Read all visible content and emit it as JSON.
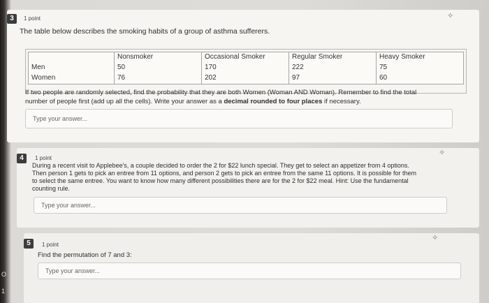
{
  "q3": {
    "number": "3",
    "points": "1 point",
    "intro": "The table below describes the smoking habits of a group of asthma sufferers.",
    "table": {
      "headers": [
        "",
        "Nonsmoker",
        "Occasional Smoker",
        "Regular Smoker",
        "Heavy Smoker"
      ],
      "rows": [
        [
          "Men",
          "50",
          "170",
          "222",
          "75"
        ],
        [
          "Women",
          "76",
          "202",
          "97",
          "60"
        ]
      ]
    },
    "question_line1": "If two people are randomly selected, find the probability that they are both Women (Woman AND Woman). Remember to find the total",
    "question_line2_pre": "number of people first (add up all the cells). Write your answer as a ",
    "question_line2_bold": "decimal rounded to four places",
    "question_line2_post": " if necessary.",
    "placeholder": "Type your answer..."
  },
  "q4": {
    "number": "4",
    "points": "1 point",
    "line1": "During a recent visit to Applebee's, a couple decided to order the 2 for $22 lunch special. They get to select an appetizer from 4 options.",
    "line2": "Then person 1 gets to pick an entree from 11 options, and person 2 gets to pick an entree from the same 11 options. It is possible for them",
    "line3": "to select the same entree. You want to know how many different possibilities there are for the 2 for $22 meal. Hint: Use the fundamental",
    "line4": "counting rule.",
    "placeholder": "Type your answer..."
  },
  "q5": {
    "number": "5",
    "points": "1 point",
    "text": "Find the permutation of 7 and 3:",
    "placeholder": "Type your answer..."
  },
  "gutter": {
    "mark1": "O",
    "mark2": "1"
  },
  "icons": {
    "pin": "pin-icon"
  }
}
